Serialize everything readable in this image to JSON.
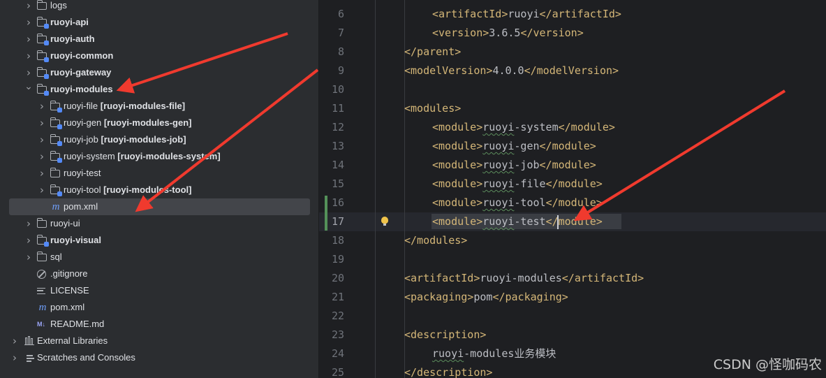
{
  "project_tree": {
    "items": [
      {
        "label": "logs",
        "suffix": "",
        "icon": "folder-icon",
        "expanded": false,
        "bold": false
      },
      {
        "label": "ruoyi-api",
        "suffix": "",
        "icon": "module-folder-icon",
        "expanded": false,
        "bold": true
      },
      {
        "label": "ruoyi-auth",
        "suffix": "",
        "icon": "module-folder-icon",
        "expanded": false,
        "bold": true
      },
      {
        "label": "ruoyi-common",
        "suffix": "",
        "icon": "module-folder-icon",
        "expanded": false,
        "bold": true
      },
      {
        "label": "ruoyi-gateway",
        "suffix": "",
        "icon": "module-folder-icon",
        "expanded": false,
        "bold": true
      },
      {
        "label": "ruoyi-modules",
        "suffix": "",
        "icon": "module-folder-icon",
        "expanded": true,
        "bold": true
      },
      {
        "label": "ruoyi-file",
        "suffix": "[ruoyi-modules-file]",
        "icon": "module-folder-icon",
        "expanded": false,
        "bold": false
      },
      {
        "label": "ruoyi-gen",
        "suffix": "[ruoyi-modules-gen]",
        "icon": "module-folder-icon",
        "expanded": false,
        "bold": false
      },
      {
        "label": "ruoyi-job",
        "suffix": "[ruoyi-modules-job]",
        "icon": "module-folder-icon",
        "expanded": false,
        "bold": false
      },
      {
        "label": "ruoyi-system",
        "suffix": "[ruoyi-modules-system]",
        "icon": "module-folder-icon",
        "expanded": false,
        "bold": false
      },
      {
        "label": "ruoyi-test",
        "suffix": "",
        "icon": "folder-icon",
        "expanded": false,
        "bold": false
      },
      {
        "label": "ruoyi-tool",
        "suffix": "[ruoyi-modules-tool]",
        "icon": "module-folder-icon",
        "expanded": false,
        "bold": false
      },
      {
        "label": "pom.xml",
        "suffix": "",
        "icon": "maven-icon",
        "expanded": null,
        "bold": false,
        "selected": true
      },
      {
        "label": "ruoyi-ui",
        "suffix": "",
        "icon": "folder-icon",
        "expanded": false,
        "bold": false
      },
      {
        "label": "ruoyi-visual",
        "suffix": "",
        "icon": "module-folder-icon",
        "expanded": false,
        "bold": true
      },
      {
        "label": "sql",
        "suffix": "",
        "icon": "folder-icon",
        "expanded": false,
        "bold": false
      },
      {
        "label": ".gitignore",
        "suffix": "",
        "icon": "gitignore-icon",
        "expanded": null,
        "bold": false
      },
      {
        "label": "LICENSE",
        "suffix": "",
        "icon": "text-file-icon",
        "expanded": null,
        "bold": false
      },
      {
        "label": "pom.xml",
        "suffix": "",
        "icon": "maven-icon",
        "expanded": null,
        "bold": false
      },
      {
        "label": "README.md",
        "suffix": "",
        "icon": "markdown-icon",
        "expanded": null,
        "bold": false
      },
      {
        "label": "External Libraries",
        "suffix": "",
        "icon": "library-icon",
        "expanded": false,
        "bold": false
      },
      {
        "label": "Scratches and Consoles",
        "suffix": "",
        "icon": "scratches-icon",
        "expanded": false,
        "bold": false
      }
    ]
  },
  "editor": {
    "current_line": 17,
    "lines": [
      {
        "num": "6",
        "indent": 2,
        "tokens": [
          [
            "t",
            "<artifactId>"
          ],
          [
            "x",
            "ruoyi"
          ],
          [
            "t",
            "</artifactId>"
          ]
        ]
      },
      {
        "num": "7",
        "indent": 2,
        "tokens": [
          [
            "t",
            "<version>"
          ],
          [
            "x",
            "3.6.5"
          ],
          [
            "t",
            "</version>"
          ]
        ]
      },
      {
        "num": "8",
        "indent": 1,
        "tokens": [
          [
            "t",
            "</parent>"
          ]
        ]
      },
      {
        "num": "9",
        "indent": 1,
        "tokens": [
          [
            "t",
            "<modelVersion>"
          ],
          [
            "x",
            "4.0.0"
          ],
          [
            "t",
            "</modelVersion>"
          ]
        ]
      },
      {
        "num": "10",
        "indent": 0,
        "tokens": []
      },
      {
        "num": "11",
        "indent": 1,
        "tokens": [
          [
            "t",
            "<modules>"
          ]
        ]
      },
      {
        "num": "12",
        "indent": 2,
        "tokens": [
          [
            "t",
            "<module>"
          ],
          [
            "w",
            "ruoyi"
          ],
          [
            "x",
            "-system"
          ],
          [
            "t",
            "</module>"
          ]
        ]
      },
      {
        "num": "13",
        "indent": 2,
        "tokens": [
          [
            "t",
            "<module>"
          ],
          [
            "w",
            "ruoyi"
          ],
          [
            "x",
            "-gen"
          ],
          [
            "t",
            "</module>"
          ]
        ]
      },
      {
        "num": "14",
        "indent": 2,
        "tokens": [
          [
            "t",
            "<module>"
          ],
          [
            "w",
            "ruoyi"
          ],
          [
            "x",
            "-job"
          ],
          [
            "t",
            "</module>"
          ]
        ]
      },
      {
        "num": "15",
        "indent": 2,
        "tokens": [
          [
            "t",
            "<module>"
          ],
          [
            "w",
            "ruoyi"
          ],
          [
            "x",
            "-file"
          ],
          [
            "t",
            "</module>"
          ]
        ]
      },
      {
        "num": "16",
        "indent": 2,
        "tokens": [
          [
            "t",
            "<module>"
          ],
          [
            "w",
            "ruoyi"
          ],
          [
            "x",
            "-tool"
          ],
          [
            "t",
            "</module>"
          ]
        ]
      },
      {
        "num": "17",
        "indent": 2,
        "tokens": [
          [
            "t",
            "<module>"
          ],
          [
            "w",
            "ruoyi"
          ],
          [
            "x",
            "-test"
          ],
          [
            "t",
            "</module>"
          ]
        ]
      },
      {
        "num": "18",
        "indent": 1,
        "tokens": [
          [
            "t",
            "</modules>"
          ]
        ]
      },
      {
        "num": "19",
        "indent": 0,
        "tokens": []
      },
      {
        "num": "20",
        "indent": 1,
        "tokens": [
          [
            "t",
            "<artifactId>"
          ],
          [
            "x",
            "ruoyi-modules"
          ],
          [
            "t",
            "</artifactId>"
          ]
        ]
      },
      {
        "num": "21",
        "indent": 1,
        "tokens": [
          [
            "t",
            "<packaging>"
          ],
          [
            "x",
            "pom"
          ],
          [
            "t",
            "</packaging>"
          ]
        ]
      },
      {
        "num": "22",
        "indent": 0,
        "tokens": []
      },
      {
        "num": "23",
        "indent": 1,
        "tokens": [
          [
            "t",
            "<description>"
          ]
        ]
      },
      {
        "num": "24",
        "indent": 2,
        "tokens": [
          [
            "w",
            "ruoyi"
          ],
          [
            "x",
            "-modules业务模块"
          ]
        ]
      },
      {
        "num": "25",
        "indent": 1,
        "tokens": [
          [
            "t",
            "</description>"
          ]
        ]
      }
    ]
  },
  "watermark": "CSDN @怪咖码农",
  "colors": {
    "tag": "#d5b778",
    "text": "#bcbec4",
    "annotation_arrow": "#f03a2e",
    "accent": "#548af7"
  }
}
